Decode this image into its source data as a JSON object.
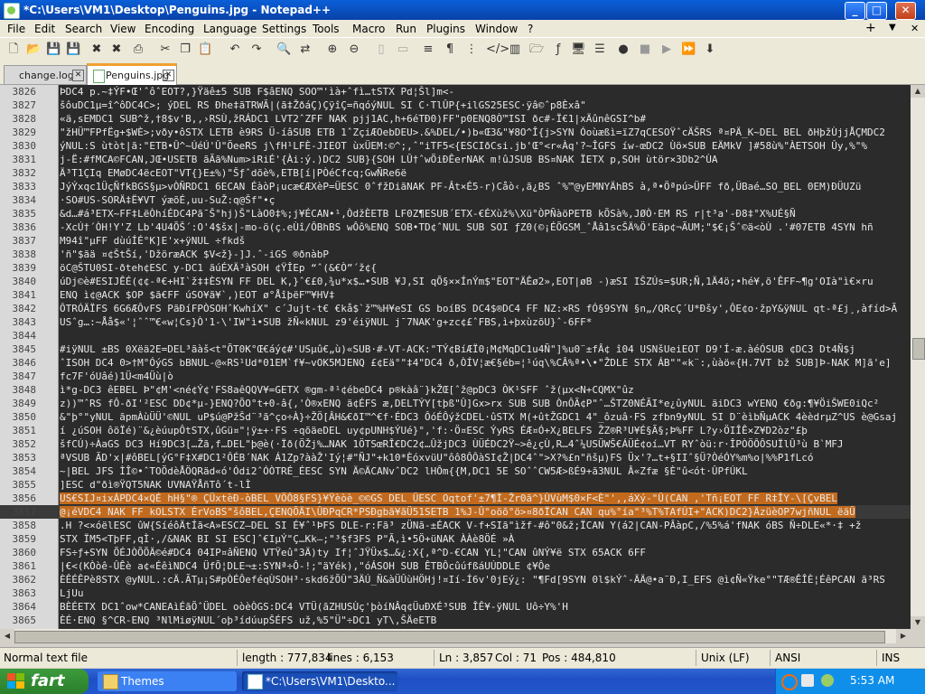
{
  "window": {
    "title": "*C:\\Users\\VM1\\Desktop\\Penguins.jpg - Notepad++",
    "minimize": "_",
    "maximize": "□",
    "close": "✕"
  },
  "menu": {
    "items": [
      "File",
      "Edit",
      "Search",
      "View",
      "Encoding",
      "Language",
      "Settings",
      "Tools",
      "Macro",
      "Run",
      "Plugins",
      "Window",
      "?"
    ],
    "right_plus": "+",
    "right_down": "▼",
    "right_close": "✕"
  },
  "tabs": [
    {
      "label": "change.log",
      "close": "✕"
    },
    {
      "label": "Penguins.jpg",
      "close": "✕"
    }
  ],
  "editor": {
    "lines": [
      {
        "n": "3826",
        "t": "ÞDC4  p.~‡ÝF•Œ'ˆôˆEOT?,}Ÿäê±5 SUB F$âENQ SOO™'ìà+ˆfì…tSTX Pd¦Šl]m<-"
      },
      {
        "n": "3827",
        "t": "šôuDC1µ=î^ôDC4C>; ýDEL RS Ðhe‡ãTRWÃ|(ã‡ŽðáÇ)ÇÿîÇ=ñqóýNUL SI C·TlÛP{+ilGS25ESC·ÿâ©ˆp8Èxâ\""
      },
      {
        "n": "3828",
        "t": "«ä,sEMDC1 SUB^ž,†8$v'B‚,›RSÙ,žRÁDC1 LVT2ˆZFF NAK pjj1AC,h+6éTÐ0)FF\"p0ENQ8Ò™ISI ðc#-Ï€1|xÄûnêGSI^b#"
      },
      {
        "n": "3829",
        "t": "\"žHÜ™FPfËg+$WÈ>;vðy•ôSTX LETB è9RS Ü-íâSUB ETB 1ˆZçiÆOebDEU>.&%DEL/•)b«Œ3&\"¥8O^Î{j>SYN Óoùæßì=ïZ7qCESOŸˆcÄŠRS ª¤PÄ_K~DEL BEL ðHþžÙjjÅÇMDC2"
      },
      {
        "n": "3830",
        "t": "ýNUL:S ùtòt|ã:\"ETB•Û^~ÚéÚ'Û\"ÖeeRS j\\fH¹LFÈ-JIEOT ùxÜEM:©^;,ˆ\"iTF5<{ESCIðCsi.jb'Œ°<r«Àq'?~ÎGFS íw-œDC2 Ùö×SUB EÄMkV ]#58ù%\"ÀETSOH Ûy,%\"%"
      },
      {
        "n": "3831",
        "t": "j-Ë:#fMCA©FCAN,JŒ•USETB ãÃã%Num>iRiÉ'{Ài:ý.)DC2 SUB}{SOH LÛ†ˆwÕiÐÊerNAK m!ûJSUB BS¤NAK ÏETX p,SOH ùtör×3Db2^ÙA"
      },
      {
        "n": "3832",
        "t": "Ä³T1ÇIq EMøDC4ëcEOT\"VT{}E±%)\"Šƒˆdõè%,ETB[í|PÒéCfcq;GwÑRe6ë"
      },
      {
        "n": "3833",
        "t": "JýÝxqc1ÜçÑfkBGS§µ>vÒÑRDC1 6ECAN ÉàòP¡ucæ€ÆXèP=ÜESC 0ˆfžDiãNAK PF-Ât×É5-r)Cåò‹,ã¿BS ˆ%™@yEMNYÄhBS à,ª•Öªpú>ÜFF fð,ÜBaé…SO_BEL 0EM)ÐÜUZü"
      },
      {
        "n": "3834",
        "t": "·SO#US-SORÄ‡Ë¥VT ýæõÉ,uu-SuŽ:q@Šf\"•ç"
      },
      {
        "n": "3835",
        "t": "&d…#á³ETX~FF‡LëÒhíÉDC4Pã¯Š°hj)Š\"LàO0‡%;j¥ÉCAN•¹,ÒdžÈETB LF0Z¶ESUB´ETX-€ÉXùž%\\Xü°ÒPÑàöPETB kÕSà%,JØÒ·EM RS r|t³a'-Ð8‡°X%UÉ§Ñ"
      },
      {
        "n": "3836",
        "t": "-XcÚ†´ÒH!Y'Z Lb'4U4ÕŠ´:O'4$šx|-mo-ö(ç.eÙî/ÔBhBS wÔô%ENQ SOB•TD¢ˆNUL SUB SOI ƒZ0(©¡ÉÕGSM_ˆÅâ1scŠÄ%Ö'Eäp¢¬ÃUM;\"$€¡Šˆ©ä<òÙ .'#07ETB 4SYN hñ"
      },
      {
        "n": "3837",
        "t": "M94î\"µFF dùúÍÉ°K]E'x+ÿNUL ÷fkdš"
      },
      {
        "n": "3838",
        "t": "'ñ\"$ãä  ¤¢ŠtŠí,'DžöræACK $V<ž}-]J.ˆ-iGS ®ðnàbP"
      },
      {
        "n": "3839",
        "t": "öC@ŠTU0SI-ðteh¢ESC y-DC1 ãúÉXÄ³àSOH ¢ŸÎEp “ˆ(&€Ò”´ž¢{"
      },
      {
        "n": "3840",
        "t": "úDj©è#ESIJÊÉ(¢¢-ª€+HI`ž‡‡ÈSYN FF DEL K,}ˆ€£0,¾u*x$…•SUB ¥J,SI qÕ§××ÍnÝm$\"EOT\"ÄÊø2»,EOT|øB -)æSI IŠZÚs=$UR;Ñ,1Ä4ö;•hé¥,õ'ÊFF~¶g'OIà\"ì€×ru"
      },
      {
        "n": "3841",
        "t": "ENQ ì¢@ACK $OP $ã€FF úSO¥ã¥`,)EOT ø°ÅîþëF™¥HV‡"
      },
      {
        "n": "3842",
        "t": "ÔTRÓÄÏFS 6G6ÆÔvFS PãÐíFPÒSOHˆKwhíX\"  c´Jujt-t€ €kå$`ž™%H¥eSI GS boíBS DC4$®DC4 FF NZ:×RS fÓ§9SYN §n„/QRcÇ´U*Ðšy',ÔE¢o·žpY&ÿNUL qt-ª£j¸,àfíd>Ã"
      },
      {
        "n": "3843",
        "t": "USˆg…:~Åå$«'¦ˆˆ™€«w¦Cs}Ò'1-\\'IW\"ì•SUB žÑ«kNUL z9'éiÿNUL j¯7NAK'g+zc¢£ˆFBS,ì+þxùzõU}ˆ-6FF*"
      },
      {
        "n": "3844",
        "t": ""
      },
      {
        "n": "3845",
        "t": "#iÿNUL ±BS 0Xëä2E=DEL³ãàš<t\"ÕT0K°Œ€áý¢#'USµû€„ù)«SUB·#-VT-ACK:\"TÝ¢BíÆÏ0¡M¢MqDC1u4Ñ\"]%u0¨±fÂ¢ î04 USNšUeiEOT D9'Í-æ.àéÓSUB ¢DC3 Dt4Ñ$j"
      },
      {
        "n": "3846",
        "t": "ˆISOH DC4 0>†M°ÓýGS bBNUL-@«RS¹Ud*01EM`f¥~vOK5MJENQ £¢Eä°\"‡4\"DC4 ð,ÒÍV¦æ€§éb=¦¹úq\\%CÂ%ª•\\•\"ŽDLE STX ÁB\"\"«k¨:,ùàö«{H.7VT bž SUB]Þ-NAK M]ã'e]"
      },
      {
        "n": "3847",
        "t": "fc7F'óUâé)1Ü<m4Üù|ò"
      },
      {
        "n": "3848",
        "t": "ì*g-DC3 êEBEL Þ\"¢M'<né¢Ý¢'FS8aêQQV¥=GETX ®gm-ª¹¢ébeDC4 p®kàâ¨}kŽŒ[ˆž@pDC3 ÒK¹SFF ˆž(µx<N+CQMX\"ûz"
      },
      {
        "n": "3849",
        "t": "z))™ˆRS  fÔ-ðI'²ESC DD¢*µ-}ENQ?ÕO°t+0-â{,'Ò®xENQ ä¢ÉFS æ,DELTÝY[tþß\"Û]Gx>rx SUB SUB ÒnÔÃ¢P\"ˆ…ŠTZ0NÉÃI*e¿ûyNUL äiDC3 wYENQ €ðg:¶¥ÖiŠWE0iQc²"
      },
      {
        "n": "3850",
        "t": "&\"þ°\"yNUL ãpmÀùÜÜ'©NUL uP$ú@PžŠd¨³ã^ço÷À}÷ŽÖ[ÂH&€ðI™^€f·ÉDC3 ÔóÉÔýžCDEL·ûSTX M(+ûtŽGDC1 4\"_ôzuâ·FS zfbn9yNUL SI D¨èìbÑµACK 4èèdrµZ^US è@Gsaj"
      },
      {
        "n": "3851",
        "t": "í  ¿úSOH ôöÏé)¨&¿èúupÔtSTX,ûGü¤\"¦ÿ±+·FS ÷qõäeDEL uy¢pUNH$ÝUé}°,'f:·Ö¤ESC ÝyRS ÉÆ¤Ó+X¿BELFS ŽZ®R³U¥É§Ã§;Þ%FF L?y›ÖIÎÊ×Z¥D2òz\"£þ"
      },
      {
        "n": "3852",
        "t": "šfCÚ)÷ÀaGS DC3 Hí9DC3[…Žã,f…DEL\"þ@è(·Ïð(ÖŽj%…NAK 1ÖTSœRÎ€DC2¢…ÛžjDC3 ÙÜÉDC2Ÿ~>ê¿çÙ,R…4ˆ¼USÜWŠ€ÁÜÉ¢oí…VT RYˆòü:r·ÎPÒÖÔÔSUÏlÛ³ù  B`MFJ"
      },
      {
        "n": "3853",
        "t": "ªVSUB ÃD'x|#ôBEL[ýG°F‡X#DC1²ÔÉB´NAK Á1Zp?ààŽ'Iý¦#\"ÑJ\"+k10*ÈóxvüU\"ôô8ÔÔàSI¢Ž|DC4ˆ\">X?%£n\"ñšµ)FS Üx'?…t+§IIˆ§Ü?ÒéÓY%m%o|%%P1fLcó"
      },
      {
        "n": "3854",
        "t": "~|BEL JFS ÌÎ©•ˆTOÕdèÅÖQRäd«ó'Ódi2ˆÓÒTRÉ_ÉESC SYN Ä©ÄCANvˆDC2 lHÔm{{M,DC1  5E  SOˆˆCW5Æ>ßÉ9+ã3NUL Â«Zfæ    §È\"û<ót·ÛPfÚKL"
      },
      {
        "n": "3855",
        "t": "]ESC d\"ðì®ŸQT5NAK UVNAŸÅñTô´t-lÌ"
      },
      {
        "n": "3856",
        "t": "US€SIJ¤ixÁPDC4×QÉ hH§\"® ÇÜxtèÐ-òBEL VÖÔ8§FS}¥Ÿèòè_©©GS DEL ÜESC Oqtof'±7¶Ì-Žr0ã^}ÙVùM$0×F<È\"',,áXý-\"Û(CAN ,'Tñ¡EOT FF R‡ÎY-\\[ÇvBEL"
      },
      {
        "n": "3857",
        "t": "@¡éVDC4 NAK FF kOLSTX ÉrVoBS\"šôBEL,ÇENQÕÄI\\ÛÐPqCR*PSÐgbã¥ãÜ51SETB 1%J-Û°oöõ°ö>¤8ðÏCAN CAN qu%°ía\"³%T%TAfÚI+\"ACK)DC2}ÄzüèOP7wjñNUL ëäÛ"
      },
      {
        "n": "3858",
        "t": ".H ?<×óëlESC ûW{SíéôÄtÍã<A»ESCZ—DEL SI É¥ˆ¹ÞFS DLE-r:Fã³ zÜNã-±ÉACK V-f+SIã\"ìžf-#ô\"0&ž;ÏCAN Y(á2|CAN-PÂàpC,/%5%á'fNAK óBS Ñ÷DLE«*·‡ +ž"
      },
      {
        "n": "3859",
        "t": "STX ÏM5<TþFF,qÌ·,/&NAK BI SI ESC]ˆ€IµÝ\"Ç…Kk—;\"³$f3FS P\"Ã,ì•5Ö+üNAK ÀÀè8ÖÉ »À"
      },
      {
        "n": "3860",
        "t": "FS÷ƒ+SYN ÕÉJÒÕÕÄ©é#DC4 04IP¤âÑENQ VTŸeû°3Ä)ty If¦ˆJŸÜx$…&¿:X{,ª^D-€CAN YL¦\"CAN ûNÝ¥ë STX 65ACK 6FF"
      },
      {
        "n": "3861",
        "t": "|€<(KÒòê-ÛÊè a¢«ÉêìNDC4 ÜfÕ¦DLE¬±:SYNª÷Ô-!;\"äYék),\"óÁSOH SUB ÊTBÔcûúfßáUÚDDLE ¢¥Ôe"
      },
      {
        "n": "3862",
        "t": "ÈÊÉÊPè8STX @yNUL.:cÄ.ÃTµ¡S#pÒÉÔeféqÙSOH³·skd6žÕÛ\"3ÄÚ_Ñ&àÜÛùHÖHj!¤Ií-Í6v'0jEý¿: \"¶Fd[9SYN 0l$kÝˆ-ÄÄ@•a¨Ð,I_EFS @ì¢Ñ«Ÿke°\"TÆ®ÊÎÈ¦ÉêPCAN ã³RS"
      },
      {
        "n": "3863",
        "t": "LjUu"
      },
      {
        "n": "3864",
        "t": "BÈÉETX DC1ˆow*CANEAìÉãÕˆÜDEL oòèÒGS:DC4 VTÜ(ãZHUSÙç'þòíNÂq¢ÜuÐXÉ³SUB ÎÊ¥-ÿNUL Uô÷Y%'H"
      },
      {
        "n": "3865",
        "t": "ÈÉ·ENQ §^CR-ENQ ³NlMiøÿNUL´oþ³ídúupŠÉFS už,%5\"Ü\"÷DC1 yT\\,ŠÄeETB"
      }
    ]
  },
  "statusbar": {
    "type": "Normal text file",
    "length": "length : 777,834",
    "lines": "lines : 6,153",
    "ln": "Ln : 3,857",
    "col": "Col : 71",
    "pos": "Pos : 484,810",
    "eol": "Unix (LF)",
    "encoding": "ANSI",
    "mode": "INS"
  },
  "taskbar": {
    "start": "fart",
    "tasks": [
      "Themes",
      "*C:\\Users\\VM1\\Deskto..."
    ],
    "clock": "5:53 AM"
  }
}
